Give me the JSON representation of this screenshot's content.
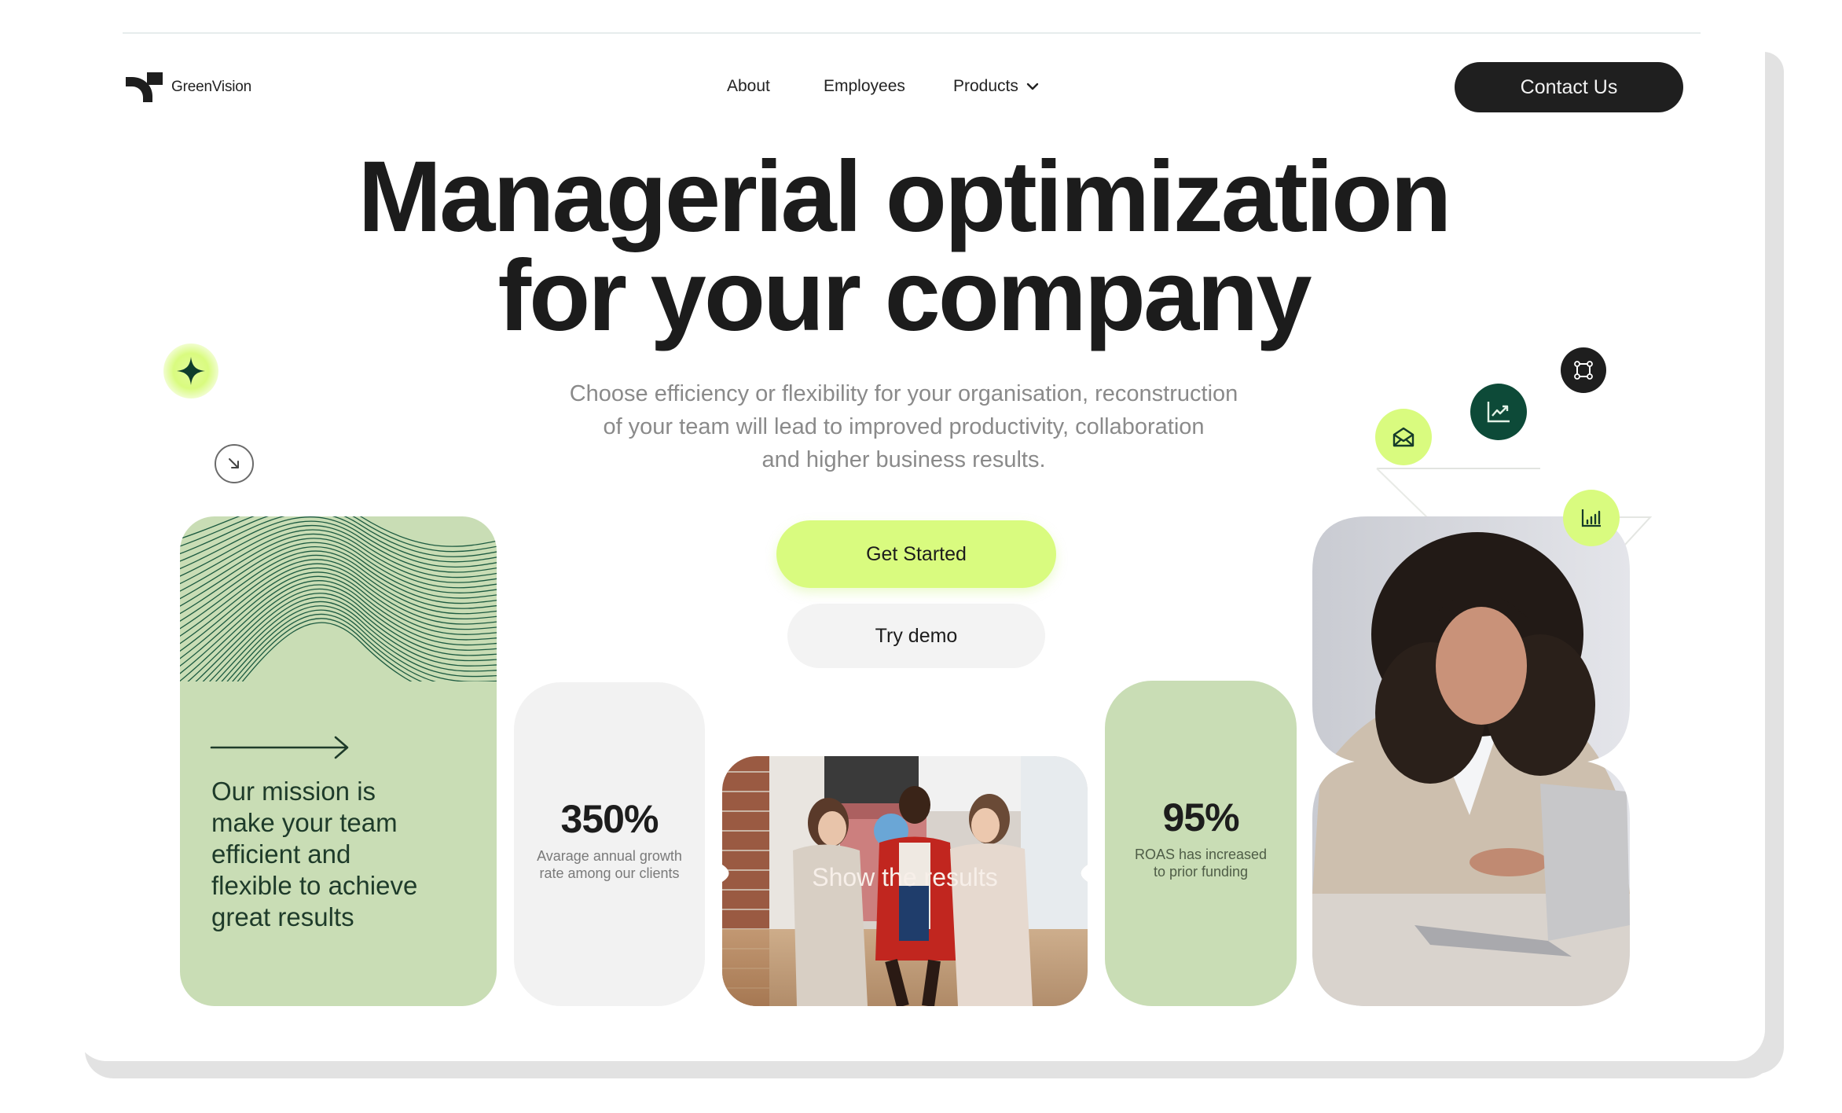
{
  "brand": {
    "name": "GreenVision",
    "logo_icon": "greenvision-logo-mark"
  },
  "nav": {
    "items": [
      {
        "label": "About"
      },
      {
        "label": "Employees"
      },
      {
        "label": "Products",
        "has_dropdown": true
      }
    ],
    "contact_label": "Contact Us"
  },
  "hero": {
    "headline_line1": "Managerial optimization",
    "headline_line2": "for your company",
    "subtitle_line1": "Choose efficiency or flexibility for your organisation, reconstruction",
    "subtitle_line2": "of your team will lead to improved productivity, collaboration",
    "subtitle_line3": "and higher business results.",
    "primary_cta": "Get Started",
    "secondary_cta": "Try demo"
  },
  "decor_icons": {
    "sparkle": "four-point-star-icon",
    "arrow": "arrow-down-right-icon",
    "mail": "envelope-open-icon",
    "chart": "trend-chart-icon",
    "frame": "vector-frame-icon",
    "bars": "bar-chart-icon"
  },
  "cards": {
    "mission": {
      "text_lines": [
        "Our mission is",
        "make your team",
        "efficient and",
        "flexible to achieve",
        "great results"
      ]
    },
    "stat_growth": {
      "value": "350%",
      "label_line1": "Avarage annual growth",
      "label_line2": "rate among our clients"
    },
    "team_photo": {
      "caption": "Show the results"
    },
    "stat_roas": {
      "value": "95%",
      "label_line1": "ROAS has increased",
      "label_line2": "to prior funding"
    }
  },
  "colors": {
    "accent_lime": "#d9fb7f",
    "sage": "#c9ddb5",
    "dark_green": "#0d4a38",
    "ink": "#1f1f1f",
    "muted_grey": "#f2f2f2"
  }
}
